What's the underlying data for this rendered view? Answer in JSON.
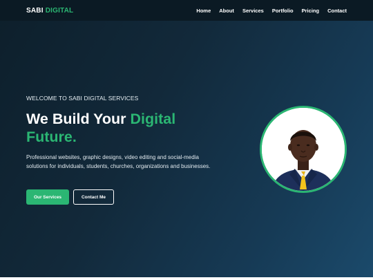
{
  "brand": {
    "name_part1": "SABI",
    "name_part2": "DIGITAL",
    "accent_color": "#2bb673"
  },
  "nav": {
    "items": [
      {
        "label": "Home"
      },
      {
        "label": "About"
      },
      {
        "label": "Services"
      },
      {
        "label": "Portfolio"
      },
      {
        "label": "Pricing"
      },
      {
        "label": "Contact"
      }
    ]
  },
  "hero": {
    "eyebrow": "WELCOME TO SABI DIGITAL SERVICES",
    "headline_part1": "We Build Your",
    "headline_part2": "Digital",
    "headline_part3": "Future.",
    "description": "Professional websites, graphic designs, video editing and social-media solutions for individuals, students, churches, organizations and businesses.",
    "primary_button": "Our Services",
    "secondary_button": "Contact Me",
    "portrait_icon": "profile-photo"
  },
  "colors": {
    "background": "#12293a",
    "accent": "#2bb673",
    "navbar": "#0b1a24"
  }
}
